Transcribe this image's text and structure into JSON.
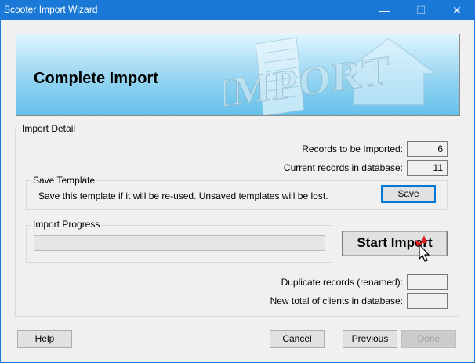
{
  "window": {
    "title": "Scooter Import Wizard",
    "minimize_glyph": "—",
    "maximize_glyph": "☐",
    "close_glyph": "✕"
  },
  "banner": {
    "title": "Complete Import",
    "art_text": "IMPORT"
  },
  "import_detail": {
    "label": "Import Detail",
    "records_to_import_label": "Records to be Imported:",
    "records_to_import_value": "6",
    "current_records_label": "Current records in database:",
    "current_records_value": "11"
  },
  "save_template": {
    "label": "Save Template",
    "message": "Save this template if it will be re-used. Unsaved templates will be lost.",
    "save_button": "Save"
  },
  "import_progress": {
    "label": "Import Progress",
    "progress": 0
  },
  "start_import_button": "Start Import",
  "results": {
    "duplicates_label": "Duplicate records (renamed):",
    "duplicates_value": "",
    "new_total_label": "New total of clients in database:",
    "new_total_value": ""
  },
  "footer": {
    "help": "Help",
    "cancel": "Cancel",
    "previous": "Previous",
    "done": "Done"
  },
  "colors": {
    "titlebar": "#1a79d6",
    "banner_top": "#dff4fd",
    "banner_bottom": "#66c0ea",
    "default_button_border": "#0078d7"
  }
}
